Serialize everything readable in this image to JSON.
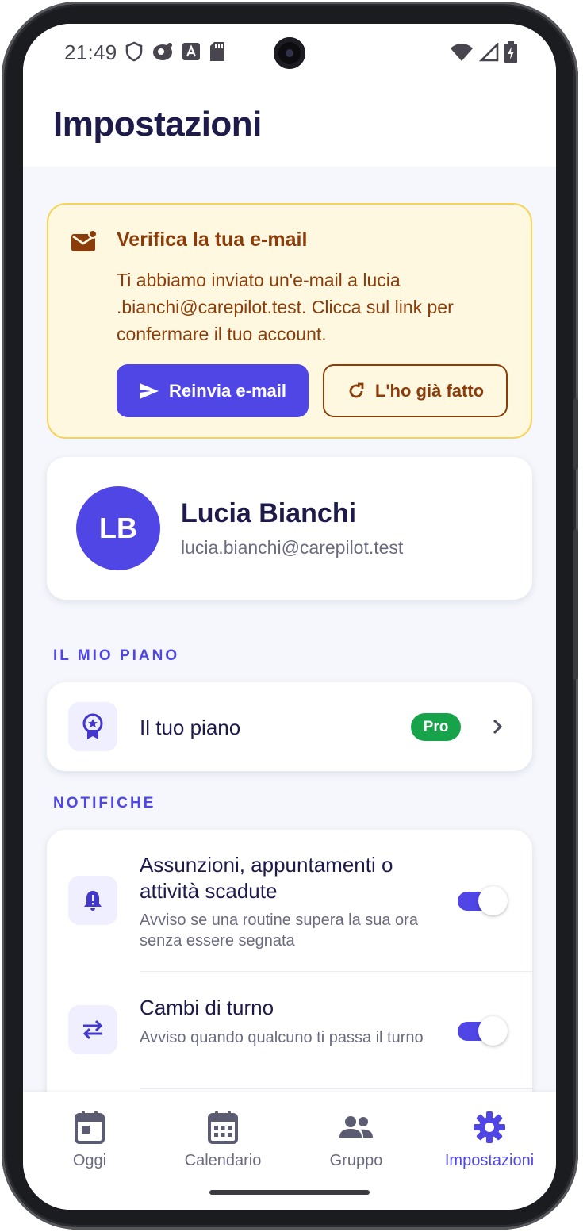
{
  "status_bar": {
    "time": "21:49",
    "icons": [
      "shield-icon",
      "location-icon",
      "font-icon",
      "sd-card-icon"
    ],
    "right_icons": [
      "wifi-icon",
      "cell-signal-icon",
      "battery-charging-icon"
    ]
  },
  "header": {
    "title": "Impostazioni"
  },
  "verify_banner": {
    "title": "Verifica la tua e-mail",
    "body": "Ti abbiamo inviato un'e-mail a lucia .bianchi@carepilot.test. Clicca sul link per confermare il tuo account.",
    "resend_label": "Reinvia e-mail",
    "done_label": "L'ho già fatto",
    "colors": {
      "background": "#fef8e1",
      "border": "#f6d45c",
      "text": "#8a3d0a"
    }
  },
  "profile": {
    "initials": "LB",
    "name": "Lucia Bianchi",
    "email": "lucia.bianchi@carepilot.test"
  },
  "plan_section": {
    "label": "IL MIO PIANO",
    "item_label": "Il tuo piano",
    "badge": "Pro"
  },
  "notifications_section": {
    "label": "NOTIFICHE",
    "items": [
      {
        "title": "Assunzioni, appuntamenti o attività scadute",
        "subtitle": "Avviso se una routine supera la sua ora senza essere segnata",
        "enabled": true,
        "icon": "bell-icon"
      },
      {
        "title": "Cambi di turno",
        "subtitle": "Avviso quando qualcuno ti passa il turno",
        "enabled": true,
        "icon": "swap-icon"
      }
    ]
  },
  "bottom_nav": {
    "items": [
      {
        "label": "Oggi",
        "icon": "calendar-today-icon",
        "active": false
      },
      {
        "label": "Calendario",
        "icon": "calendar-month-icon",
        "active": false
      },
      {
        "label": "Gruppo",
        "icon": "group-icon",
        "active": false
      },
      {
        "label": "Impostazioni",
        "icon": "gear-icon",
        "active": true
      }
    ]
  },
  "colors": {
    "accent": "#4f46e5",
    "heading": "#1e1b4b",
    "success": "#16a34a"
  }
}
